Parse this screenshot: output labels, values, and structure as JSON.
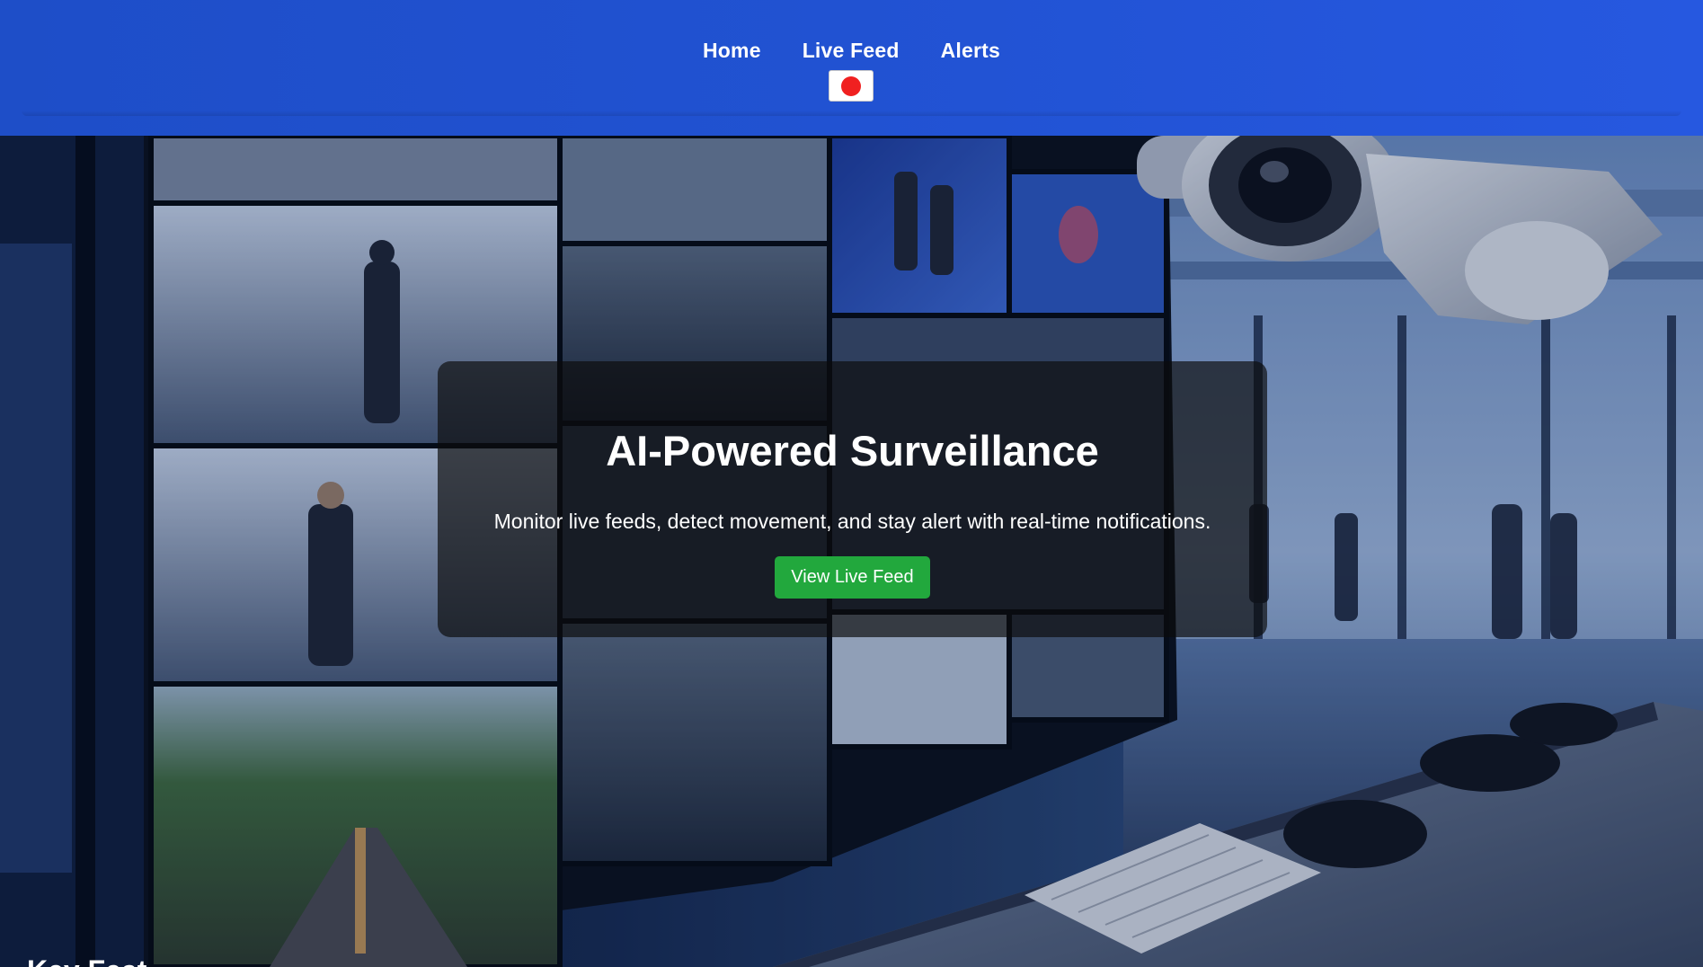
{
  "nav": {
    "links": [
      {
        "label": "Home"
      },
      {
        "label": "Live Feed",
        "indicator_icon": "recording-dot-icon"
      },
      {
        "label": "Alerts"
      }
    ],
    "indicator_color": "#f02020"
  },
  "hero": {
    "title": "AI-Powered Surveillance",
    "subtitle": "Monitor live feeds, detect movement, and stay alert with real-time notifications.",
    "cta_label": "View Live Feed",
    "background_image": "surveillance-control-room-image"
  },
  "next_section": {
    "heading_peek": "Key Feat"
  },
  "colors": {
    "nav_bg": "#2152d2",
    "cta_bg": "#22a83d",
    "card_overlay": "rgba(12,12,12,0.68)"
  }
}
